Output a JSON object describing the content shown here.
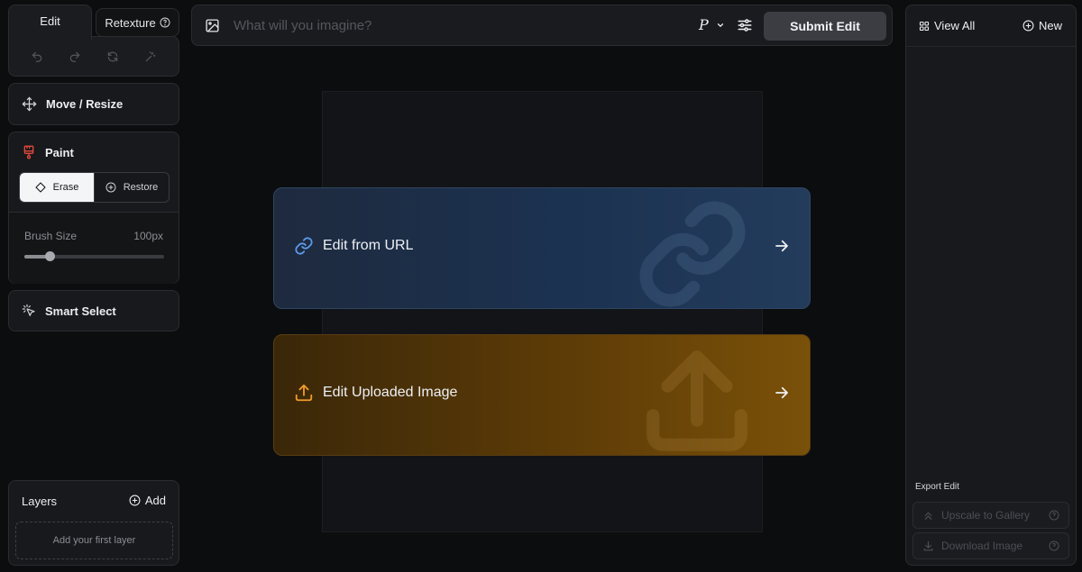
{
  "tabs": {
    "edit": "Edit",
    "retexture": "Retexture"
  },
  "tools": {
    "move_resize": "Move / Resize",
    "paint": "Paint",
    "erase": "Erase",
    "restore": "Restore",
    "brush_size_label": "Brush Size",
    "brush_size_value": "100px",
    "brush_size_fraction": 0.18,
    "smart_select": "Smart Select"
  },
  "layers": {
    "title": "Layers",
    "add": "Add",
    "empty": "Add your first layer"
  },
  "prompt": {
    "placeholder": "What will you imagine?",
    "model": "P",
    "submit": "Submit Edit"
  },
  "cards": {
    "url": "Edit from URL",
    "upload": "Edit Uploaded Image"
  },
  "right": {
    "view_all": "View All",
    "new": "New",
    "export_title": "Export Edit",
    "upscale": "Upscale to Gallery",
    "download": "Download Image"
  },
  "colors": {
    "paint_accent": "#e2483a",
    "url_icon": "#5b9be8",
    "upload_icon": "#f09a2a"
  }
}
